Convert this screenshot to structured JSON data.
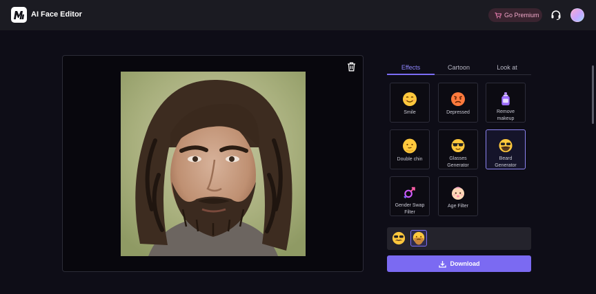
{
  "app": {
    "title": "AI Face Editor",
    "logo_text": "M"
  },
  "header": {
    "premium_label": "Go Premium",
    "premium_icon": "cart-icon",
    "support_icon": "headset-icon"
  },
  "tabs": [
    {
      "label": "Effects",
      "active": true
    },
    {
      "label": "Cartoon",
      "active": false
    },
    {
      "label": "Look at",
      "active": false
    }
  ],
  "effects": [
    {
      "label": "Smile",
      "icon": "smile-emoji"
    },
    {
      "label": "Depressed",
      "icon": "depressed-emoji"
    },
    {
      "label": "Remove\nmakeup",
      "icon": "makeup-bottle"
    },
    {
      "label": "Double chin",
      "icon": "double-chin-emoji"
    },
    {
      "label": "Glasses\nGenerator",
      "icon": "sunglasses-emoji"
    },
    {
      "label": "Beard\nGenerator",
      "icon": "beard-emoji",
      "selected": true
    },
    {
      "label": "Gender Swap\nFilter",
      "icon": "gender-swap-symbol"
    },
    {
      "label": "Age Filter",
      "icon": "baby-emoji"
    }
  ],
  "history": [
    {
      "icon": "mustache-emoji"
    },
    {
      "icon": "bearded-emoji",
      "active": true
    }
  ],
  "download": {
    "label": "Download",
    "icon": "download-icon"
  },
  "colors": {
    "accent": "#7b6af2",
    "tab_active": "#8f86ff",
    "background": "#0e0d17",
    "topbar": "#1b1b22"
  }
}
